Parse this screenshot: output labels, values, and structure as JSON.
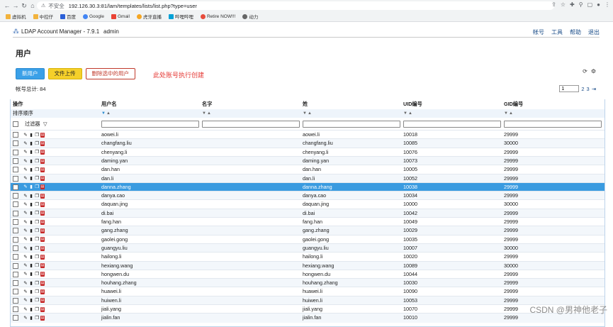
{
  "browser": {
    "insecure_label": "不安全",
    "url": "192.126.30.3:81/lam/templates/lists/list.php?type=user",
    "bookmarks": [
      "虚拟机",
      "中控仔",
      "百度",
      "Google",
      "Gmail",
      "虎牙直播",
      "哔哩哔哩",
      "Retire NOW!!!",
      "动力"
    ]
  },
  "app": {
    "title": "LDAP Account Manager - 7.9.1",
    "user": "admin",
    "menu": [
      "帐号",
      "工具",
      "帮助",
      "退出"
    ]
  },
  "page": {
    "title": "用户",
    "buttons": {
      "new": "新用户",
      "upload": "文件上传",
      "delete": "删除选中的用户"
    },
    "annotation": "此处账号执行创建",
    "count_label": "帐号总计: 84",
    "pager": {
      "current": "1",
      "pages": [
        "2",
        "3"
      ],
      "next": "⇥"
    }
  },
  "table": {
    "headers": [
      "操作",
      "用户名",
      "名字",
      "姓",
      "UID编号",
      "GID编号"
    ],
    "sort_label": "排序顺序",
    "filter_label": "过滤器",
    "rows": [
      {
        "uid": "aowei.li",
        "sn": "aowei.li",
        "uidNumber": "10018",
        "gidNumber": "29999"
      },
      {
        "uid": "changfang.liu",
        "sn": "changfang.liu",
        "uidNumber": "10085",
        "gidNumber": "30000"
      },
      {
        "uid": "chenyang.li",
        "sn": "chenyang.li",
        "uidNumber": "10076",
        "gidNumber": "29999"
      },
      {
        "uid": "daming.yan",
        "sn": "daming.yan",
        "uidNumber": "10073",
        "gidNumber": "29999"
      },
      {
        "uid": "dan.han",
        "sn": "dan.han",
        "uidNumber": "10005",
        "gidNumber": "29999"
      },
      {
        "uid": "dan.li",
        "sn": "dan.li",
        "uidNumber": "10052",
        "gidNumber": "29999"
      },
      {
        "uid": "danna.zhang",
        "sn": "danna.zhang",
        "uidNumber": "10038",
        "gidNumber": "29999",
        "selected": true
      },
      {
        "uid": "danya.cao",
        "sn": "danya.cao",
        "uidNumber": "10034",
        "gidNumber": "29999"
      },
      {
        "uid": "daquan.jing",
        "sn": "daquan.jing",
        "uidNumber": "10000",
        "gidNumber": "30000"
      },
      {
        "uid": "di.bai",
        "sn": "di.bai",
        "uidNumber": "10042",
        "gidNumber": "29999"
      },
      {
        "uid": "fang.han",
        "sn": "fang.han",
        "uidNumber": "10049",
        "gidNumber": "29999"
      },
      {
        "uid": "gang.zhang",
        "sn": "gang.zhang",
        "uidNumber": "10029",
        "gidNumber": "29999"
      },
      {
        "uid": "gaolei.gong",
        "sn": "gaolei.gong",
        "uidNumber": "10035",
        "gidNumber": "29999"
      },
      {
        "uid": "guangyu.liu",
        "sn": "guangyu.liu",
        "uidNumber": "10007",
        "gidNumber": "30000"
      },
      {
        "uid": "hailong.li",
        "sn": "hailong.li",
        "uidNumber": "10020",
        "gidNumber": "29999"
      },
      {
        "uid": "hexiang.wang",
        "sn": "hexiang.wang",
        "uidNumber": "10089",
        "gidNumber": "30000"
      },
      {
        "uid": "hongwen.du",
        "sn": "hongwen.du",
        "uidNumber": "10044",
        "gidNumber": "29999"
      },
      {
        "uid": "houhang.zhang",
        "sn": "houhang.zhang",
        "uidNumber": "10030",
        "gidNumber": "29999"
      },
      {
        "uid": "huawei.li",
        "sn": "huawei.li",
        "uidNumber": "10090",
        "gidNumber": "29999"
      },
      {
        "uid": "huiwen.li",
        "sn": "huiwen.li",
        "uidNumber": "10053",
        "gidNumber": "29999"
      },
      {
        "uid": "jiali.yang",
        "sn": "jiali.yang",
        "uidNumber": "10070",
        "gidNumber": "29999"
      },
      {
        "uid": "jialin.fan",
        "sn": "jialin.fan",
        "uidNumber": "10010",
        "gidNumber": "29999"
      }
    ]
  },
  "watermark": "CSDN @男神他老子",
  "colors": {
    "primary": "#3aa0e8",
    "upload": "#f5d02a",
    "danger": "#c0392b",
    "selected_row": "#3a9be0",
    "annotation": "#e53935"
  }
}
